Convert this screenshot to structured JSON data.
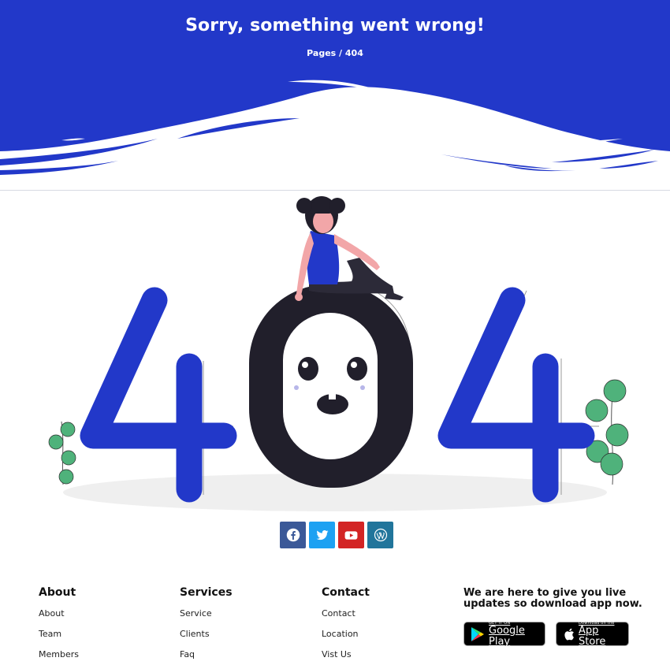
{
  "hero": {
    "title": "Sorry, something went wrong!",
    "breadcrumb": {
      "parent": "Pages",
      "separator": " / ",
      "current": "404"
    }
  },
  "illustration": {
    "digits": [
      "4",
      "0",
      "4"
    ]
  },
  "social": [
    {
      "name": "facebook",
      "icon": "facebook-icon",
      "color": "#3b5998"
    },
    {
      "name": "twitter",
      "icon": "twitter-icon",
      "color": "#1da1f2"
    },
    {
      "name": "youtube",
      "icon": "youtube-icon",
      "color": "#d32424"
    },
    {
      "name": "wordpress",
      "icon": "wordpress-icon",
      "color": "#21759b"
    }
  ],
  "footer": {
    "about": {
      "heading": "About",
      "links": [
        "About",
        "Team",
        "Members"
      ]
    },
    "services": {
      "heading": "Services",
      "links": [
        "Service",
        "Clients",
        "Faq"
      ]
    },
    "contact": {
      "heading": "Contact",
      "links": [
        "Contact",
        "Location",
        "Vist Us"
      ]
    },
    "app": {
      "text": "We are here to give you live updates so download app now.",
      "google_play": {
        "small": "GET IT ON",
        "big": "Google Play"
      },
      "app_store": {
        "small": "Download on the",
        "big": "App Store"
      }
    }
  },
  "colors": {
    "brand_blue": "#2238c9",
    "dark": "#211f2b",
    "leaf_green": "#4fb27b"
  }
}
